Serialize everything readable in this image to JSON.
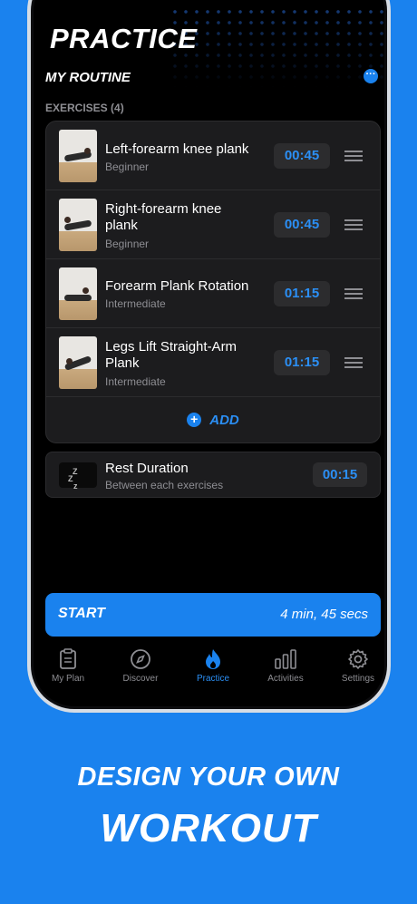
{
  "header": {
    "title": "PRACTICE",
    "routine_label": "MY ROUTINE",
    "more_icon": "ellipsis-icon"
  },
  "exercises": {
    "header": "EXERCISES (4)",
    "items": [
      {
        "name": "Left-forearm knee plank",
        "level": "Beginner",
        "time": "00:45"
      },
      {
        "name": "Right-forearm knee plank",
        "level": "Beginner",
        "time": "00:45"
      },
      {
        "name": "Forearm Plank Rotation",
        "level": "Intermediate",
        "time": "01:15"
      },
      {
        "name": "Legs Lift Straight-Arm Plank",
        "level": "Intermediate",
        "time": "01:15"
      }
    ],
    "add_label": "ADD"
  },
  "rest": {
    "title": "Rest Duration",
    "subtitle": "Between each exercises",
    "time": "00:15",
    "icon_text": "Z Z z"
  },
  "start": {
    "label": "START",
    "duration": "4 min, 45 secs"
  },
  "tabs": [
    {
      "label": "My Plan",
      "icon": "clipboard-icon",
      "active": false
    },
    {
      "label": "Discover",
      "icon": "compass-icon",
      "active": false
    },
    {
      "label": "Practice",
      "icon": "flame-icon",
      "active": true
    },
    {
      "label": "Activities",
      "icon": "bar-chart-icon",
      "active": false
    },
    {
      "label": "Settings",
      "icon": "gear-icon",
      "active": false
    }
  ],
  "promo": {
    "line1": "DESIGN YOUR OWN",
    "line2": "WORKOUT"
  },
  "colors": {
    "accent": "#1a82ee",
    "accent_text": "#2b8ff5",
    "card": "#1c1c1e",
    "muted": "#8e8e93"
  }
}
